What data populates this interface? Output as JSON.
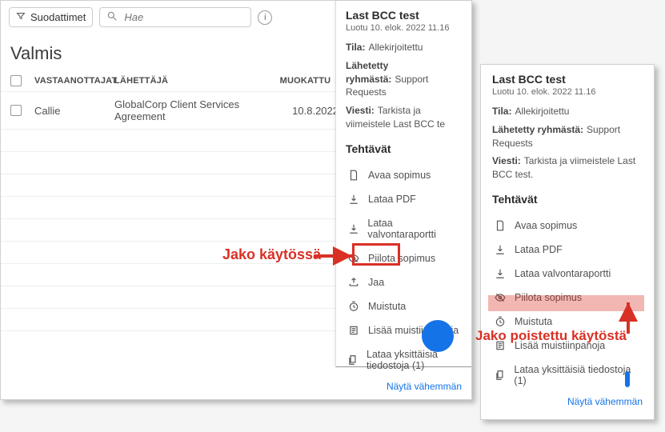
{
  "filters": {
    "label": "Suodattimet",
    "search_placeholder": "Hae"
  },
  "section_title": "Valmis",
  "table": {
    "headers": {
      "recipients": "VASTAANOTTAJAT",
      "sender": "LÄHETTÄJÄ",
      "modified": "MUOKATTU"
    },
    "row": {
      "recipient": "Callie",
      "sender": "GlobalCorp Client Services Agreement",
      "modified": "10.8.2022"
    }
  },
  "panel1": {
    "title": "Last BCC test",
    "created": "Luotu 10. elok. 2022 11.16",
    "status_label": "Tila:",
    "status_value": "Allekirjoitettu",
    "group_label": "Lähetetty ryhmästä:",
    "group_value": "Support Requests",
    "message_label": "Viesti:",
    "message_value": "Tarkista ja viimeistele Last BCC te",
    "tasks_title": "Tehtävät",
    "tasks": {
      "open": "Avaa sopimus",
      "pdf": "Lataa PDF",
      "audit": "Lataa valvontaraportti",
      "hide": "Piilota sopimus",
      "share": "Jaa",
      "remind": "Muistuta",
      "notes": "Lisää muistiinpanoja",
      "files": "Lataa yksittäisiä tiedostoja (1)"
    },
    "show_less": "Näytä vähemmän"
  },
  "panel2": {
    "title": "Last BCC test",
    "created": "Luotu 10. elok. 2022 11.16",
    "status_label": "Tila:",
    "status_value": "Allekirjoitettu",
    "group_label": "Lähetetty ryhmästä:",
    "group_value": "Support Requests",
    "message_label": "Viesti:",
    "message_value": "Tarkista ja viimeistele Last BCC test.",
    "tasks_title": "Tehtävät",
    "tasks": {
      "open": "Avaa sopimus",
      "pdf": "Lataa PDF",
      "audit": "Lataa valvontaraportti",
      "hide": "Piilota sopimus",
      "remind": "Muistuta",
      "notes": "Lisää muistiinpanoja",
      "files": "Lataa yksittäisiä tiedostoja (1)"
    },
    "show_less": "Näytä vähemmän"
  },
  "annotations": {
    "share_enabled": "Jako käytössä",
    "share_disabled": "Jako poistettu käytöstä"
  }
}
